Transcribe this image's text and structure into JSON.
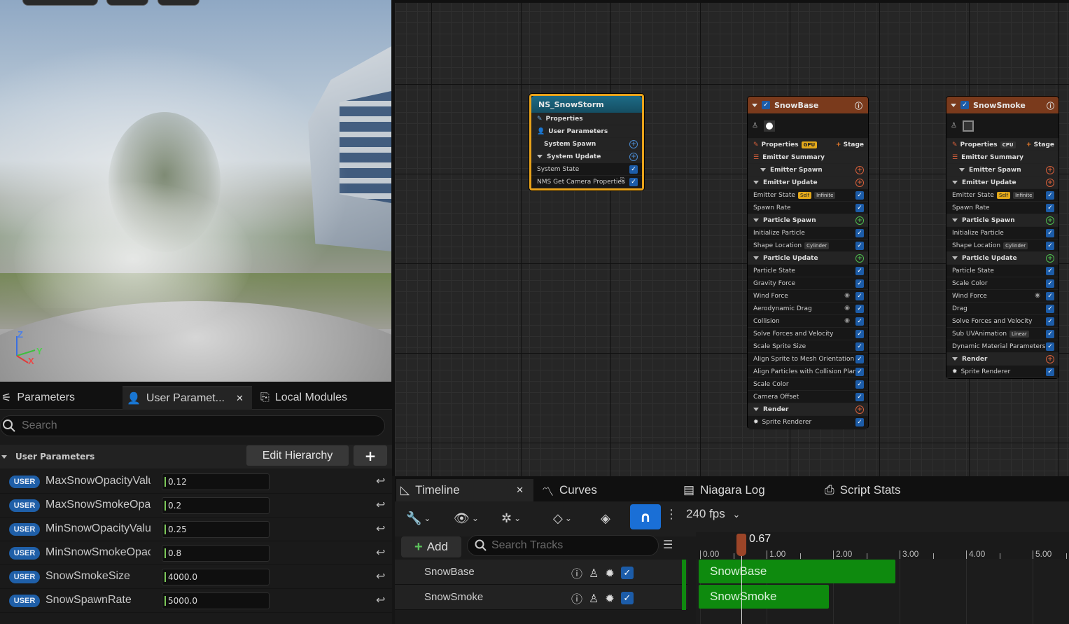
{
  "viewport": {
    "axes": {
      "z": "Z",
      "y": "Y",
      "x": "X"
    }
  },
  "left_panel": {
    "tabs": [
      {
        "label": "Parameters",
        "icon": "sliders-icon"
      },
      {
        "label": "User Paramet...",
        "icon": "user-icon",
        "close": "✕"
      },
      {
        "label": "Local Modules",
        "icon": "module-icon"
      }
    ],
    "search_placeholder": "Search",
    "section_label": "User Parameters",
    "edit_hierarchy": "Edit Hierarchy",
    "add_label": "+",
    "badge": "USER",
    "params": [
      {
        "name": "MaxSnowOpacityValue",
        "value": "0.12"
      },
      {
        "name": "MaxSnowSmokeOpacity",
        "value": "0.2"
      },
      {
        "name": "MinSnowOpacityValue",
        "value": "0.25"
      },
      {
        "name": "MinSnowSmokeOpacity",
        "value": "0.8"
      },
      {
        "name": "SnowSmokeSize",
        "value": "4000.0"
      },
      {
        "name": "SnowSpawnRate",
        "value": "5000.0"
      }
    ]
  },
  "graph": {
    "system_node": {
      "title": "NS_SnowStorm",
      "rows": [
        "Properties",
        "User Parameters",
        "System Spawn",
        "System Update",
        "System State",
        "NMS Get Camera Properties"
      ]
    },
    "emitter_common": {
      "properties": "Properties",
      "stage": "Stage",
      "self_tag": "Self",
      "infinite_tag": "Infinite",
      "cylinder_tag": "Cylinder",
      "linear_tag": "Linear",
      "gpu_tag": "GPU",
      "cpu_tag": "CPU"
    },
    "snowbase": {
      "title": "SnowBase",
      "rows": [
        "Emitter Summary",
        "Emitter Spawn",
        "Emitter Update",
        "Emitter State",
        "Spawn Rate",
        "Particle Spawn",
        "Initialize Particle",
        "Shape Location",
        "Particle Update",
        "Particle State",
        "Gravity Force",
        "Wind Force",
        "Aerodynamic Drag",
        "Collision",
        "Solve Forces and Velocity",
        "Scale Sprite Size",
        "Align Sprite to Mesh Orientation",
        "Align Particles with Collision Plane",
        "Scale Color",
        "Camera Offset",
        "Render",
        "Sprite Renderer"
      ]
    },
    "snowsmoke": {
      "title": "SnowSmoke",
      "rows": [
        "Emitter Summary",
        "Emitter Spawn",
        "Emitter Update",
        "Emitter State",
        "Spawn Rate",
        "Particle Spawn",
        "Initialize Particle",
        "Shape Location",
        "Particle Update",
        "Particle State",
        "Scale Color",
        "Wind Force",
        "Drag",
        "Solve Forces and Velocity",
        "Sub UVAnimation",
        "Dynamic Material Parameters",
        "Render",
        "Sprite Renderer"
      ]
    }
  },
  "timeline": {
    "tabs": [
      {
        "label": "Timeline",
        "close": "✕"
      },
      {
        "label": "Curves"
      },
      {
        "label": "Niagara Log"
      },
      {
        "label": "Script Stats"
      }
    ],
    "fps": "240 fps",
    "add_label": "Add",
    "search_placeholder": "Search Tracks",
    "playhead": "0.67",
    "ticks": [
      "0.00",
      "1.00",
      "2.00",
      "3.00",
      "4.00",
      "5.00"
    ],
    "tracks": [
      {
        "name": "SnowBase",
        "start": 0.0,
        "end": 3.0
      },
      {
        "name": "SnowSmoke",
        "start": 0.0,
        "end": 2.0
      }
    ]
  },
  "colors": {
    "accent": "#1a6fd6",
    "track_green": "#0e8a0e",
    "system_outline": "#e8a21a",
    "emitter_header": "#7a3a1c"
  }
}
